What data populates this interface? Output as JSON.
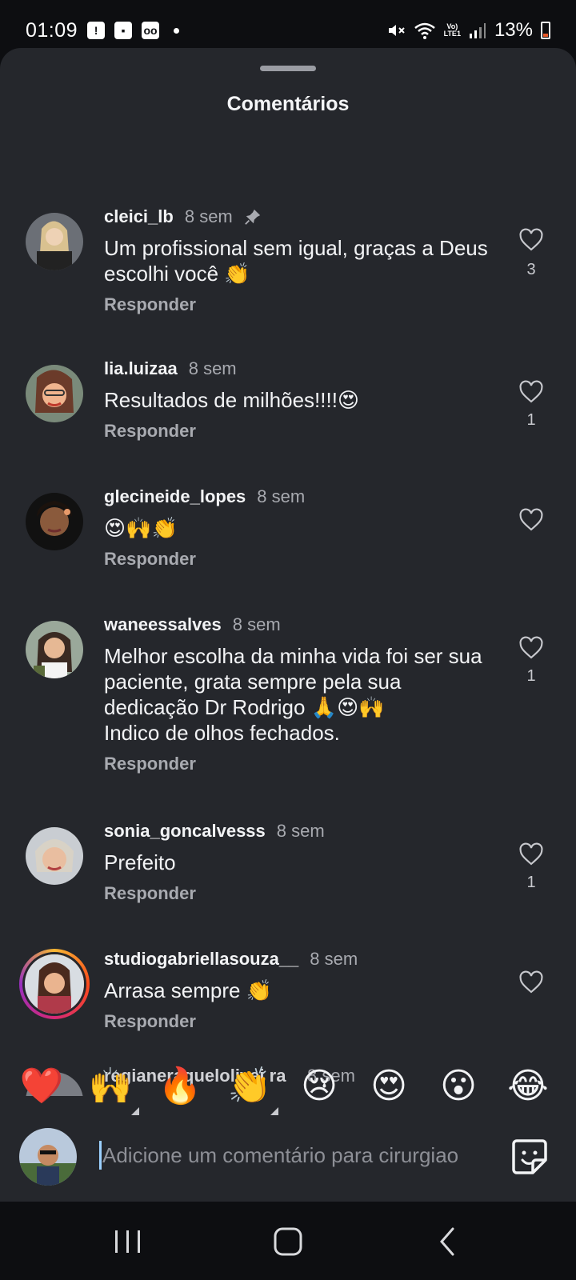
{
  "status_bar": {
    "time": "01:09",
    "battery": "13%",
    "network": "LTE1"
  },
  "sheet": {
    "title": "Comentários"
  },
  "comments": [
    {
      "username": "cleici_lb",
      "time": "8 sem",
      "pinned": true,
      "text": "Um profissional sem igual, graças a Deus escolhi você 👏",
      "reply": "Responder",
      "likes": "3"
    },
    {
      "username": "lia.luizaa",
      "time": "8 sem",
      "text": "Resultados de milhões!!!!😍",
      "reply": "Responder",
      "likes": "1"
    },
    {
      "username": "glecineide_lopes",
      "time": "8 sem",
      "text": "😍🙌👏",
      "reply": "Responder",
      "likes": ""
    },
    {
      "username": "waneessalves",
      "time": "8 sem",
      "text": "Melhor escolha da minha vida foi ser sua paciente, grata sempre pela sua dedicação Dr Rodrigo 🙏😍🙌",
      "text2": "Indico de olhos fechados.",
      "reply": "Responder",
      "likes": "1"
    },
    {
      "username": "sonia_goncalvesss",
      "time": "8 sem",
      "text": "Prefeito",
      "reply": "Responder",
      "likes": "1"
    },
    {
      "username": "studiogabriellasouza__",
      "time": "8 sem",
      "text": "Arrasa sempre 👏",
      "reply": "Responder",
      "likes": ""
    }
  ],
  "partial_comment": {
    "username": "regianeraquelolivei ra",
    "time": "8 sem"
  },
  "quick_reactions": [
    "❤️",
    "🙌",
    "🔥",
    "👏",
    "😢",
    "😍",
    "😮",
    "😂"
  ],
  "composer": {
    "placeholder": "Adicione um comentário para cirurgiao"
  },
  "nav": {
    "recents": "recents-icon",
    "home": "home-icon",
    "back": "back-icon"
  }
}
